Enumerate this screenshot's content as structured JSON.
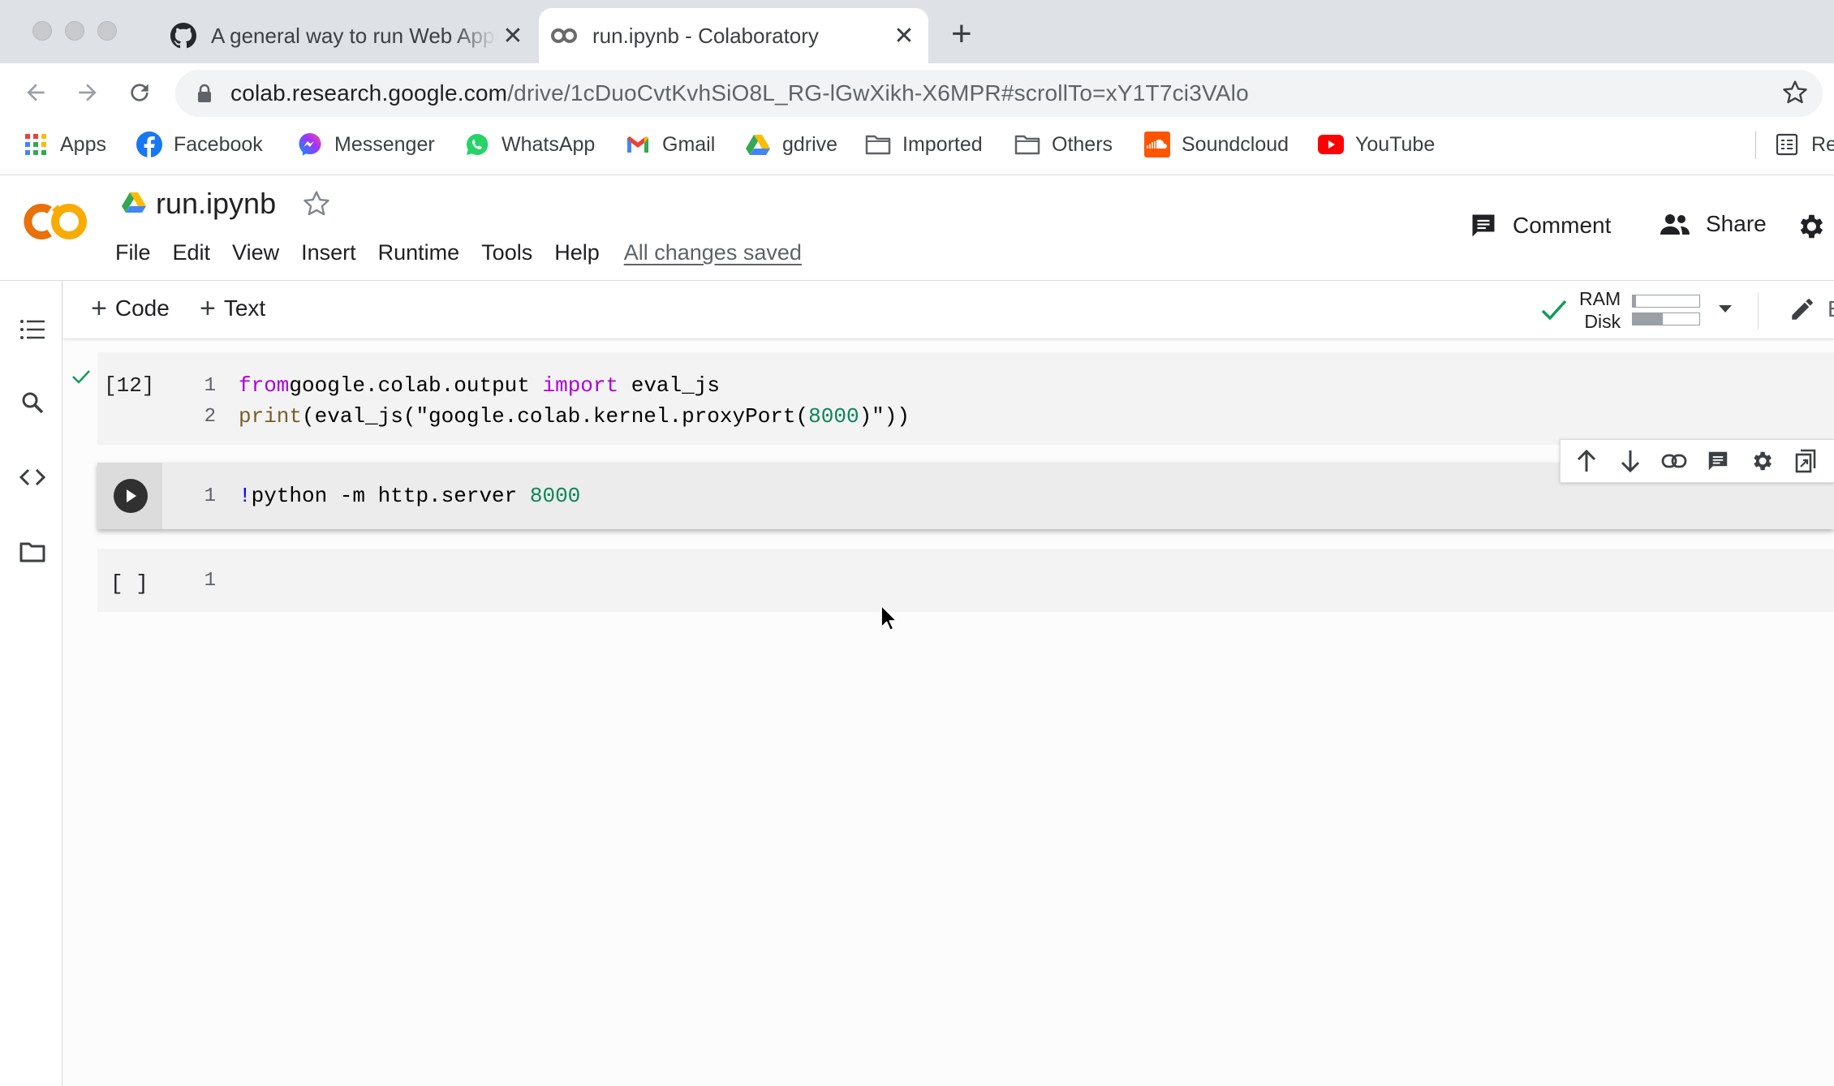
{
  "browser": {
    "tabs": [
      {
        "title": "A general way to run Web Appl",
        "close": "✕",
        "icon": "github-icon"
      },
      {
        "title": "run.ipynb - Colaboratory",
        "close": "✕",
        "icon": "colab-icon"
      }
    ],
    "new_tab": "+",
    "url_host": "colab.research.google.com",
    "url_path": "/drive/1cDuoCvtKvhSiO8L_RG-lGwXikh-X6MPR#scrollTo=xY1T7ci3VAlo",
    "bookmarks": [
      {
        "label": "Apps",
        "icon": "apps-grid-icon"
      },
      {
        "label": "Facebook",
        "icon": "facebook-icon"
      },
      {
        "label": "Messenger",
        "icon": "messenger-icon"
      },
      {
        "label": "WhatsApp",
        "icon": "whatsapp-icon"
      },
      {
        "label": "Gmail",
        "icon": "gmail-icon"
      },
      {
        "label": "gdrive",
        "icon": "gdrive-icon"
      },
      {
        "label": "Imported",
        "icon": "folder-icon"
      },
      {
        "label": "Others",
        "icon": "folder-icon"
      },
      {
        "label": "Soundcloud",
        "icon": "soundcloud-icon"
      },
      {
        "label": "YouTube",
        "icon": "youtube-icon"
      },
      {
        "label": "Re",
        "icon": "reading-list-icon"
      }
    ]
  },
  "colab": {
    "title": "run.ipynb",
    "menu": [
      "File",
      "Edit",
      "View",
      "Insert",
      "Runtime",
      "Tools",
      "Help"
    ],
    "save_status": "All changes saved",
    "comment_label": "Comment",
    "share_label": "Share",
    "toolbar": {
      "add_code": "Code",
      "add_text": "Text",
      "ram_label": "RAM",
      "disk_label": "Disk",
      "ram_usage": 0.05,
      "disk_usage": 0.45,
      "editing_label": "Editing"
    }
  },
  "cells": [
    {
      "exec_count": "[12]",
      "status": "executed",
      "lines": [
        {
          "n": "1",
          "tokens": [
            [
              "kw",
              "from"
            ],
            [
              "",
              "google.colab.output "
            ],
            [
              "kw",
              "import"
            ],
            [
              "",
              " eval_js"
            ]
          ]
        },
        {
          "n": "2",
          "tokens": [
            [
              "fn",
              "print"
            ],
            [
              "",
              "(eval_js("
            ],
            [
              "str",
              "\"google.colab.kernel.proxyPort("
            ],
            [
              "num",
              "8000"
            ],
            [
              "str",
              ")\""
            ],
            [
              "",
              "))"
            ]
          ]
        }
      ]
    },
    {
      "exec_count": "",
      "status": "focused",
      "lines": [
        {
          "n": "1",
          "tokens": [
            [
              "op",
              "!"
            ],
            [
              "",
              "python -m http.server "
            ],
            [
              "num",
              "8000"
            ]
          ]
        }
      ]
    },
    {
      "exec_count": "[ ]",
      "status": "empty",
      "lines": [
        {
          "n": "1",
          "tokens": []
        }
      ]
    }
  ],
  "colors": {
    "keyword": "#af00db",
    "function": "#795e26",
    "number": "#098658",
    "bang": "#0000ff",
    "check": "#0f9d58",
    "colab_orange": "#f9ab00",
    "colab_dark_orange": "#e8710a"
  }
}
